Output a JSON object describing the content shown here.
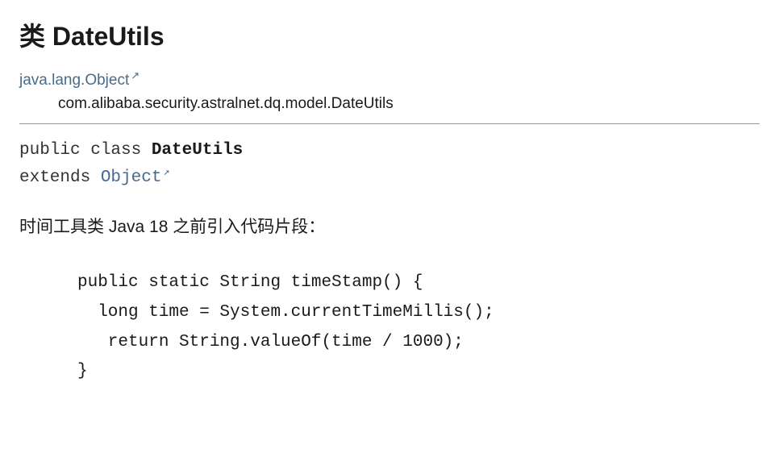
{
  "title": {
    "prefix": "类 ",
    "className": "DateUtils"
  },
  "inheritance": {
    "parent": "java.lang.Object",
    "child": "com.alibaba.security.astralnet.dq.model.DateUtils"
  },
  "signature": {
    "modifiers": "public class ",
    "className": "DateUtils",
    "extendsKeyword": "extends ",
    "superType": "Object"
  },
  "description": "时间工具类 Java 18 之前引入代码片段：",
  "code": {
    "line1": "public static String timeStamp() {",
    "line2": "  long time = System.currentTimeMillis();",
    "line3": "   return String.valueOf(time / 1000);",
    "line4": "}"
  },
  "icons": {
    "external": "↗"
  }
}
